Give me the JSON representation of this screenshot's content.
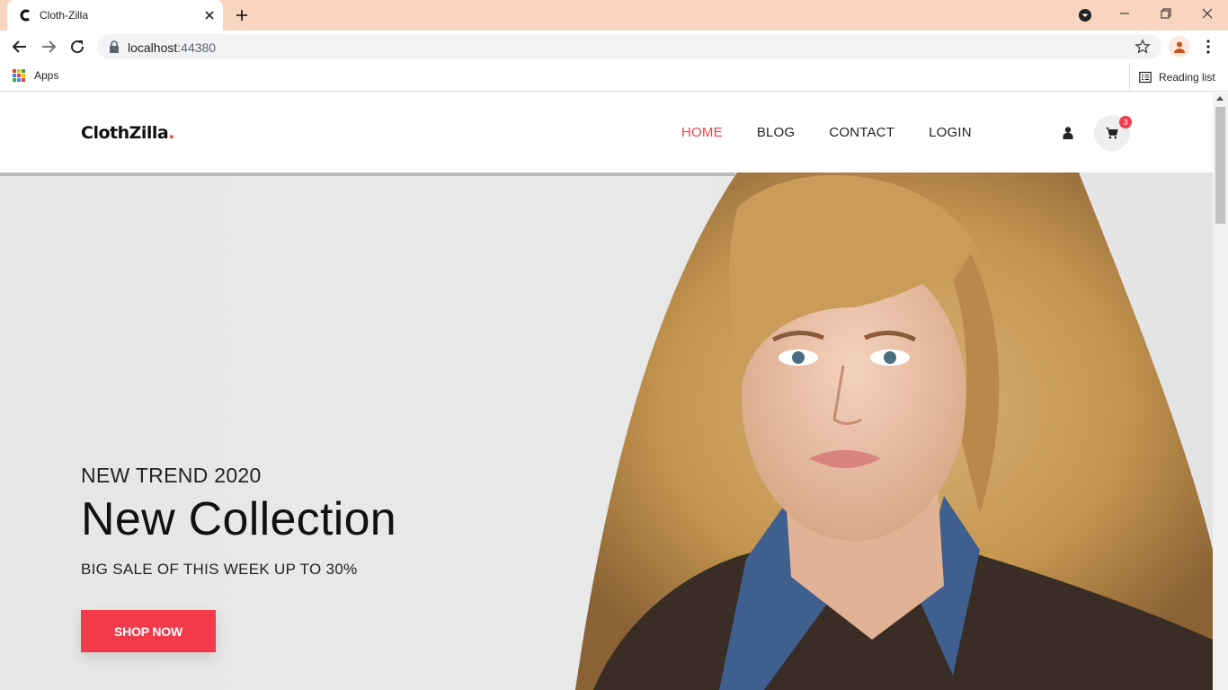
{
  "browser": {
    "tab": {
      "title": "Cloth-Zilla"
    },
    "address": {
      "host": "localhost",
      "port": ":44380"
    },
    "bookmarks": {
      "apps_label": "Apps",
      "reading_list_label": "Reading list"
    },
    "apps_colors": [
      "#ea4335",
      "#fbbc04",
      "#34a853",
      "#4285f4",
      "#ea4335",
      "#fbbc04",
      "#34a853",
      "#4285f4",
      "#ea4335"
    ]
  },
  "site": {
    "logo": {
      "text": "ClothZilla",
      "dot": "."
    },
    "nav": [
      "HOME",
      "BLOG",
      "CONTACT",
      "LOGIN"
    ],
    "active_nav": "HOME",
    "cart_count": "3",
    "hero": {
      "eyebrow": "NEW TREND 2020",
      "headline": "New Collection",
      "subline": "BIG SALE OF THIS WEEK UP TO 30%",
      "cta": "SHOP NOW"
    },
    "accent_color": "#f23a4a"
  }
}
